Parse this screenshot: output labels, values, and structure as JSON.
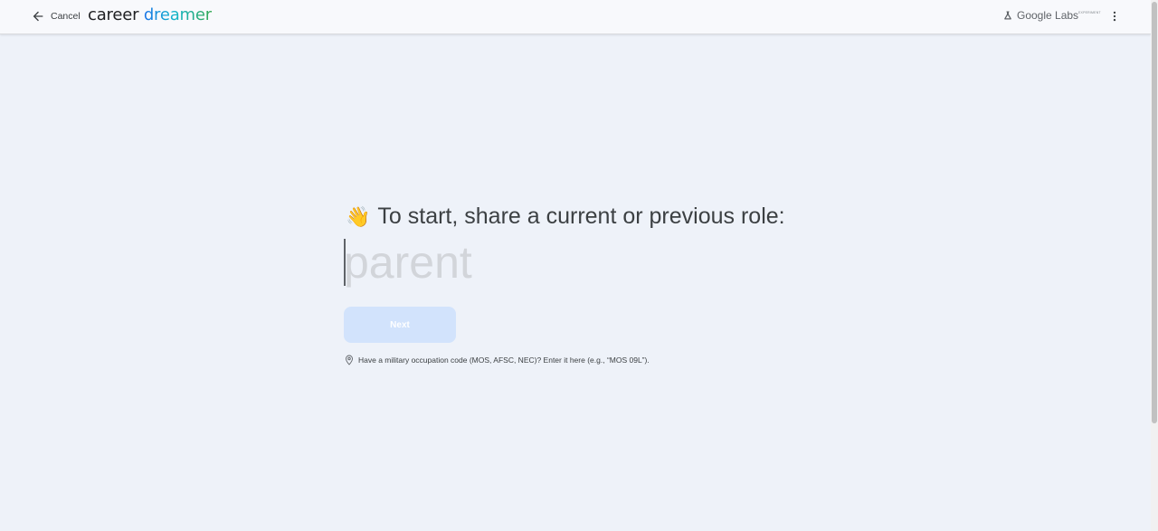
{
  "header": {
    "cancel_label": "Cancel",
    "brand_word1": "career",
    "brand_word2": "dreamer",
    "labs_label": "Google Labs",
    "labs_badge": "EXPERIMENT"
  },
  "main": {
    "wave_emoji": "👋",
    "prompt": "To start, share a current or previous role:",
    "role_input": {
      "value": "",
      "placeholder": "parent"
    },
    "next_label": "Next",
    "hint": "Have a military occupation code (MOS, AFSC, NEC)? Enter it here (e.g., “MOS 09L”)."
  },
  "colors": {
    "page_bg": "#eef2f9",
    "topbar_bg": "#f8f9fc",
    "next_button_disabled": "#d2e3fc",
    "brand_gradient": [
      "#1a73e8",
      "#12b5cb",
      "#34a853"
    ]
  },
  "icons": [
    "arrow-back-icon",
    "labs-flask-icon",
    "more-vert-icon",
    "waving-hand-icon",
    "location-pin-icon"
  ]
}
